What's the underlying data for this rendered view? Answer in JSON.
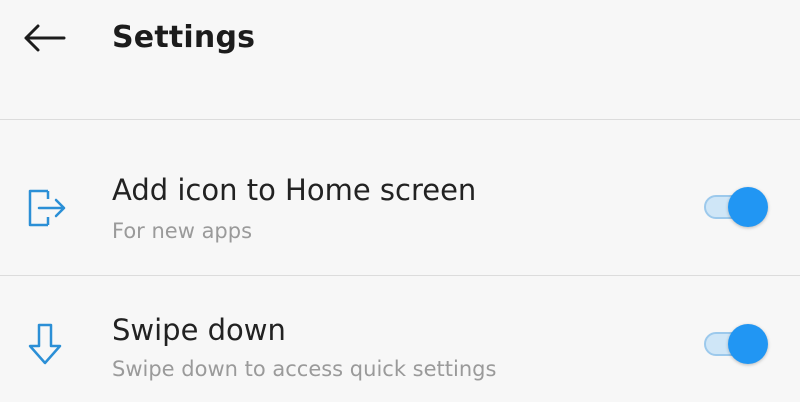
{
  "header": {
    "title": "Settings"
  },
  "settings": [
    {
      "title": "Add icon to Home screen",
      "subtitle": "For new apps",
      "icon": "add-to-home-icon",
      "enabled": true
    },
    {
      "title": "Swipe down",
      "subtitle": "Swipe down to access quick settings",
      "icon": "swipe-down-icon",
      "enabled": true
    }
  ],
  "colors": {
    "accent": "#2196f3",
    "icon": "#2b8fd6"
  }
}
